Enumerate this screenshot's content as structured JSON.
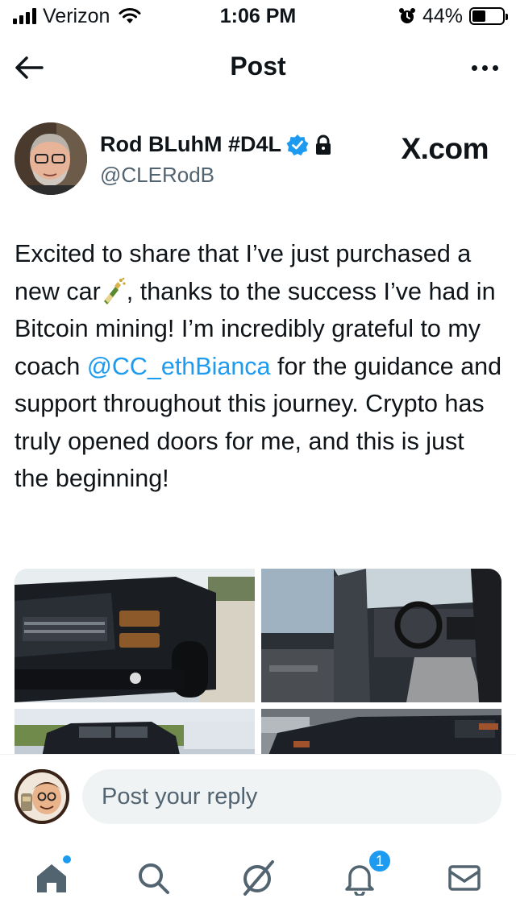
{
  "status_bar": {
    "carrier": "Verizon",
    "time": "1:06 PM",
    "battery_percent": "44%",
    "battery_level": 0.44,
    "icons": [
      "signal-icon",
      "wifi-icon",
      "alarm-icon",
      "battery-icon"
    ]
  },
  "header": {
    "title": "Post",
    "back_icon": "back-arrow-icon",
    "more_icon": "more-icon"
  },
  "author": {
    "name": "Rod BLuhM #D4L",
    "handle": "@CLERodB",
    "verified": true,
    "protected": true,
    "brand": "X.com"
  },
  "tweet": {
    "text_before_emoji": "Excited to share that I’ve just purchased a new car",
    "text_after_emoji": ", thanks to the success I’ve had in Bitcoin mining! I’m incredibly grateful to my coach ",
    "mention": "@CC_ethBianca",
    "text_end": " for the guidance and support throughout this journey. Crypto has truly opened doors for me, and this is just the beginning!",
    "emoji": "champagne-bottle-icon"
  },
  "media": {
    "photos": [
      {
        "name": "truck-front-photo"
      },
      {
        "name": "truck-interior-photo"
      },
      {
        "name": "truck-side-photo"
      },
      {
        "name": "truck-rear-photo"
      }
    ]
  },
  "composer": {
    "placeholder": "Post your reply"
  },
  "tabbar": {
    "notification_count": "1",
    "tabs": [
      "home-icon",
      "search-icon",
      "grok-icon",
      "notifications-icon",
      "messages-icon"
    ],
    "accent": "#1d9bf0"
  }
}
